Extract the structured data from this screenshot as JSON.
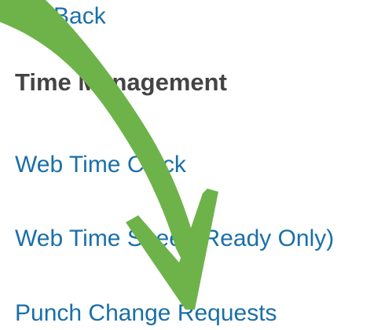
{
  "nav": {
    "back_label": "Back"
  },
  "section": {
    "title": "Time Management"
  },
  "menu": {
    "items": [
      {
        "label": "Web Time Clock"
      },
      {
        "label": "Web Time Sheet (Ready Only)"
      },
      {
        "label": "Punch Change Requests"
      }
    ]
  },
  "annotation": {
    "arrow_color": "#6db34a",
    "arrow_icon": "curved-arrow-down-icon"
  },
  "colors": {
    "link": "#1a6fa8",
    "heading": "#444444",
    "background": "#ffffff"
  }
}
